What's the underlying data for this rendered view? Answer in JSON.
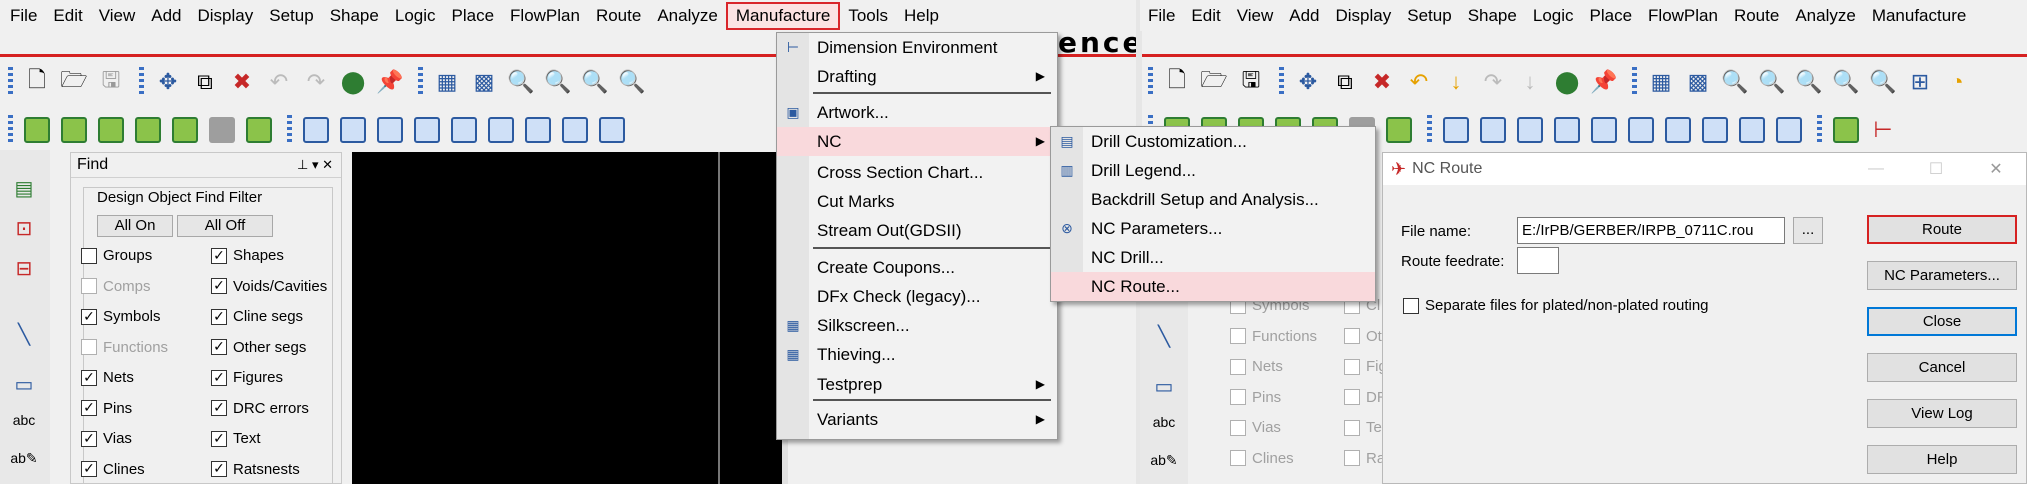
{
  "left_window": {
    "menubar": [
      "File",
      "Edit",
      "View",
      "Add",
      "Display",
      "Setup",
      "Shape",
      "Logic",
      "Place",
      "FlowPlan",
      "Route",
      "Analyze",
      "Manufacture",
      "Tools",
      "Help"
    ],
    "title_fragment": "ence",
    "find_panel": {
      "title": "Find",
      "pin_glyphs": "⊥ ▾ ✕",
      "group_label": "Design Object Find Filter",
      "all_on": "All On",
      "all_off": "All Off",
      "left_column": [
        {
          "label": "Groups",
          "checked": false,
          "enabled": true
        },
        {
          "label": "Comps",
          "checked": false,
          "enabled": false
        },
        {
          "label": "Symbols",
          "checked": true,
          "enabled": true
        },
        {
          "label": "Functions",
          "checked": false,
          "enabled": false
        },
        {
          "label": "Nets",
          "checked": true,
          "enabled": true
        },
        {
          "label": "Pins",
          "checked": true,
          "enabled": true
        },
        {
          "label": "Vias",
          "checked": true,
          "enabled": true
        },
        {
          "label": "Clines",
          "checked": true,
          "enabled": true
        }
      ],
      "right_column": [
        {
          "label": "Shapes",
          "checked": true
        },
        {
          "label": "Voids/Cavities",
          "checked": true
        },
        {
          "label": "Cline segs",
          "checked": true
        },
        {
          "label": "Other segs",
          "checked": true
        },
        {
          "label": "Figures",
          "checked": true
        },
        {
          "label": "DRC errors",
          "checked": true
        },
        {
          "label": "Text",
          "checked": true
        },
        {
          "label": "Ratsnests",
          "checked": true
        }
      ]
    }
  },
  "manufacture_menu": {
    "items": [
      {
        "label": "Dimension Environment",
        "submenu": false
      },
      {
        "label": "Drafting",
        "submenu": true
      },
      {
        "label": "Artwork...",
        "submenu": false
      },
      {
        "label": "NC",
        "submenu": true,
        "highlighted": true
      },
      {
        "label": "Cross Section Chart...",
        "submenu": false
      },
      {
        "label": "Cut Marks",
        "submenu": false
      },
      {
        "label": "Stream Out(GDSII)",
        "submenu": false
      },
      {
        "label": "Create Coupons...",
        "submenu": false
      },
      {
        "label": "DFx Check (legacy)...",
        "submenu": false
      },
      {
        "label": "Silkscreen...",
        "submenu": false
      },
      {
        "label": "Thieving...",
        "submenu": false
      },
      {
        "label": "Testprep",
        "submenu": true
      },
      {
        "label": "Variants",
        "submenu": true
      }
    ]
  },
  "nc_submenu": {
    "items": [
      {
        "label": "Drill Customization..."
      },
      {
        "label": "Drill Legend..."
      },
      {
        "label": "Backdrill Setup and Analysis..."
      },
      {
        "label": "NC Parameters..."
      },
      {
        "label": "NC Drill..."
      },
      {
        "label": "NC Route...",
        "highlighted": true
      }
    ]
  },
  "right_window": {
    "menubar": [
      "File",
      "Edit",
      "View",
      "Add",
      "Display",
      "Setup",
      "Shape",
      "Logic",
      "Place",
      "FlowPlan",
      "Route",
      "Analyze",
      "Manufacture"
    ],
    "find_list": [
      "Symbols",
      "Functions",
      "Nets",
      "Pins",
      "Vias",
      "Clines"
    ],
    "find_list_right": [
      "Cl",
      "Ot",
      "Fig",
      "DR",
      "Te",
      "Ra"
    ]
  },
  "nc_route_dialog": {
    "title": "NC Route",
    "file_name_label": "File name:",
    "file_name_value": "E:/IrPB/GERBER/IRPB_0711C.rou",
    "browse_label": "...",
    "feedrate_label": "Route feedrate:",
    "feedrate_value": "",
    "separate_label": "Separate files for plated/non-plated routing",
    "separate_checked": false,
    "buttons": [
      "Route",
      "NC Parameters...",
      "Close",
      "Cancel",
      "View Log",
      "Help"
    ],
    "window_controls": [
      "—",
      "☐",
      "✕"
    ]
  },
  "colors": {
    "accent_red": "#d62121",
    "menu_highlight": "#f9d9dc",
    "focus_blue": "#0078d7",
    "canvas": "#000000"
  }
}
